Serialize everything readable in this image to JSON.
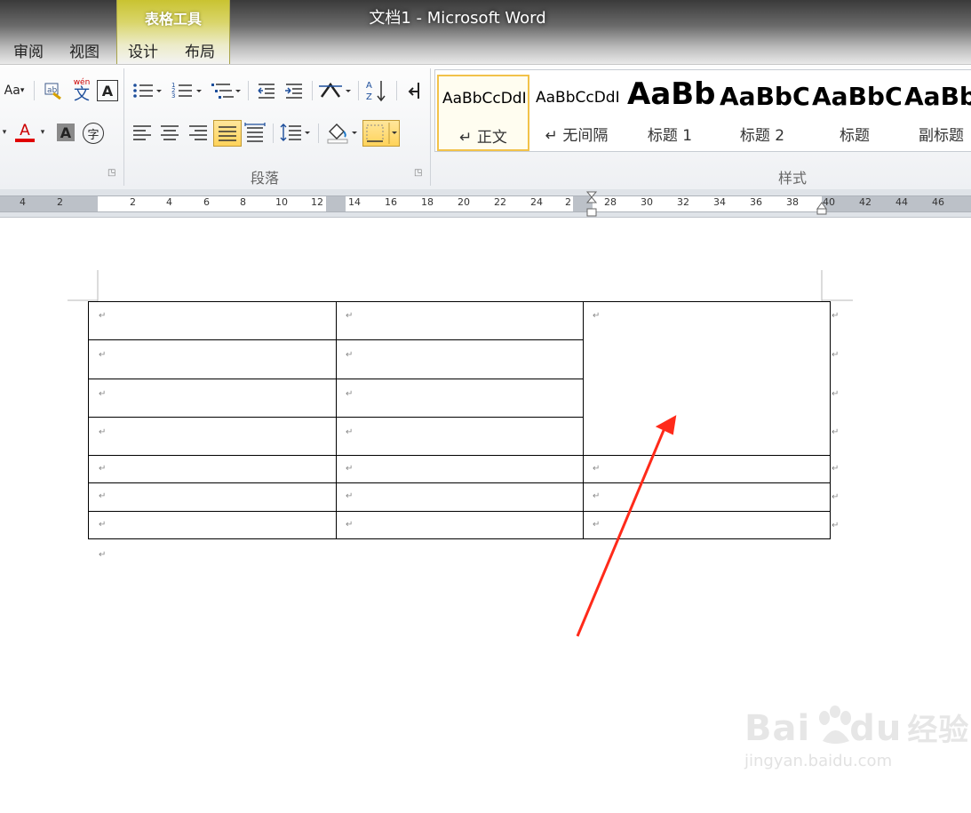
{
  "window": {
    "title": "文档1  -  Microsoft Word"
  },
  "context_tool": {
    "label": "表格工具"
  },
  "tabs": [
    {
      "label": "审阅"
    },
    {
      "label": "视图"
    },
    {
      "label": "设计"
    },
    {
      "label": "布局"
    }
  ],
  "ribbon": {
    "font_group": {
      "change_case_label": "Aa",
      "font_color_letter": "A",
      "highlight_letter": "A",
      "enclose_char": "字",
      "phonetic_label": "wén",
      "phonetic_char": "文"
    },
    "paragraph_group": {
      "label": "段落"
    },
    "styles_group": {
      "label": "样式",
      "items": [
        {
          "preview": "AaBbCcDdI",
          "name": "↵ 正文",
          "selected": true
        },
        {
          "preview": "AaBbCcDdI",
          "name": "↵ 无间隔",
          "selected": false
        },
        {
          "preview": "AaBb",
          "name": "标题 1",
          "selected": false
        },
        {
          "preview": "AaBbC",
          "name": "标题 2",
          "selected": false
        },
        {
          "preview": "AaBbC",
          "name": "标题",
          "selected": false
        },
        {
          "preview": "AaBb",
          "name": "副标题",
          "selected": false
        }
      ]
    }
  },
  "ruler": {
    "labels": [
      "4",
      "2",
      "2",
      "4",
      "6",
      "8",
      "10",
      "12",
      "14",
      "16",
      "18",
      "20",
      "22",
      "24",
      "2",
      "28",
      "30",
      "32",
      "34",
      "36",
      "38",
      "40",
      "42",
      "44",
      "46"
    ]
  },
  "document": {
    "paragraph_mark": "↵"
  },
  "watermark": {
    "brand": "Bai",
    "brand2": "du",
    "brand_cn": "经验",
    "url": "jingyan.baidu.com"
  },
  "colors": {
    "arrow": "#ff2a1a",
    "font_color_bar": "#e00000",
    "selected_style_border": "#f2c24a"
  }
}
